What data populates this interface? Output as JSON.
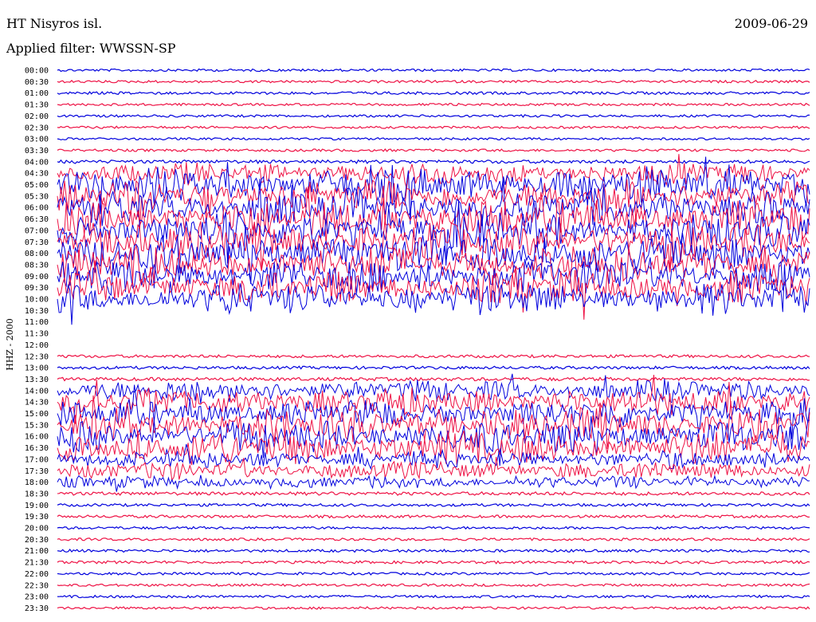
{
  "header": {
    "station": "HT Nisyros isl.",
    "date": "2009-06-29",
    "filter": "Applied filter: WWSSN-SP"
  },
  "chart_data": {
    "type": "line",
    "title": "HT Nisyros isl.",
    "ylabel": "HHZ - 2000",
    "colors": {
      "trace_a": "#0000dd",
      "trace_b": "#ee1144",
      "background": "#ffffff"
    },
    "row_labels": [
      "00:00",
      "00:30",
      "01:00",
      "01:30",
      "02:00",
      "02:30",
      "03:00",
      "03:30",
      "04:00",
      "04:30",
      "05:00",
      "05:30",
      "06:00",
      "06:30",
      "07:00",
      "07:30",
      "08:00",
      "08:30",
      "09:00",
      "09:30",
      "10:00",
      "10:30",
      "11:00",
      "11:30",
      "12:00",
      "12:30",
      "13:00",
      "13:30",
      "14:00",
      "14:30",
      "15:00",
      "15:30",
      "16:00",
      "16:30",
      "17:00",
      "17:30",
      "18:00",
      "18:30",
      "19:00",
      "19:30",
      "20:00",
      "20:30",
      "21:00",
      "21:30",
      "22:00",
      "22:30",
      "23:00",
      "23:30"
    ],
    "trace_color_cycle": [
      "trace_a",
      "trace_b"
    ],
    "activity_level": [
      0.05,
      0.05,
      0.08,
      0.05,
      0.05,
      0.04,
      0.03,
      0.05,
      0.15,
      0.55,
      0.85,
      0.85,
      0.9,
      0.95,
      0.95,
      0.95,
      0.95,
      0.9,
      0.9,
      0.85,
      0.8,
      0.0,
      0.0,
      0.0,
      0.0,
      0.1,
      0.1,
      0.15,
      0.55,
      0.7,
      0.7,
      0.85,
      0.8,
      0.85,
      0.45,
      0.45,
      0.3,
      0.15,
      0.08,
      0.08,
      0.06,
      0.06,
      0.08,
      0.08,
      0.06,
      0.05,
      0.06,
      0.05
    ],
    "grid": false,
    "legend": "none"
  }
}
